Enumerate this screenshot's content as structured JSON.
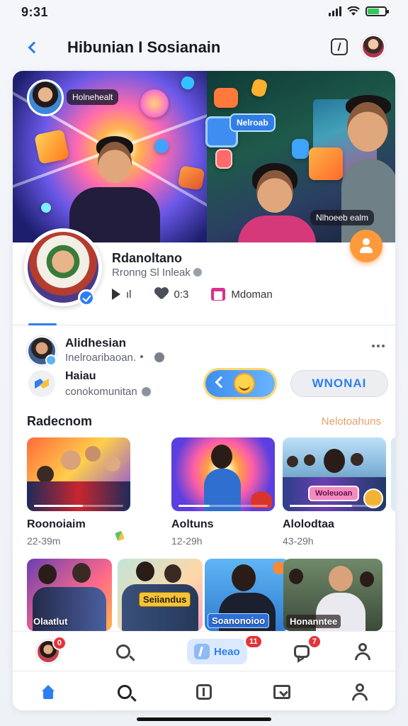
{
  "status_bar": {
    "time": "9:31",
    "battery_level": 0.65
  },
  "header": {
    "title": "Hibunian I Sosianain",
    "back_icon": "chevron-left-icon",
    "action_icon": "edit-icon"
  },
  "hero": {
    "badge_left": "Holnehealt",
    "badge_center": "Nelroab",
    "badge_right": "Nlhoeeb ealm"
  },
  "profile": {
    "name": "Rdanoltano",
    "subtitle": "Rronng Sl Inleak",
    "stat_play": "ıl",
    "stat_likes": "0:3",
    "stat_tag": "Mdoman"
  },
  "row_a": {
    "name": "Alidhesian",
    "sub1": "Inelroaribaoan.",
    "sub2": ""
  },
  "row_b": {
    "name": "Haiau",
    "sub": "conokomunitan",
    "cta": "WNONAI"
  },
  "section": {
    "title": "Radecnom",
    "link": "Nelotoahuns"
  },
  "videos": [
    {
      "title": "Roonoiaim",
      "meta": "22-39m",
      "progress": 0.55
    },
    {
      "title": "Aoltuns",
      "meta": "12-29h",
      "progress": 0.35,
      "tag": ""
    },
    {
      "title": "Alolodtaa",
      "meta": "43-29h",
      "progress": 0.7,
      "tag": "Woleuoan"
    }
  ],
  "shorts": [
    {
      "label": "Olaatlut"
    },
    {
      "label": "Seiiandus"
    },
    {
      "label": "Soanonoioo"
    },
    {
      "label": "Honanntee"
    }
  ],
  "quickbar": {
    "avatar_badge": "0",
    "center_label": "Heao",
    "center_badge": "11",
    "chat_badge": "7"
  },
  "colors": {
    "accent": "#2d7ff0",
    "cta_orange": "#ff9a3c",
    "link": "#e8a06a",
    "badge_red": "#e5333a"
  }
}
